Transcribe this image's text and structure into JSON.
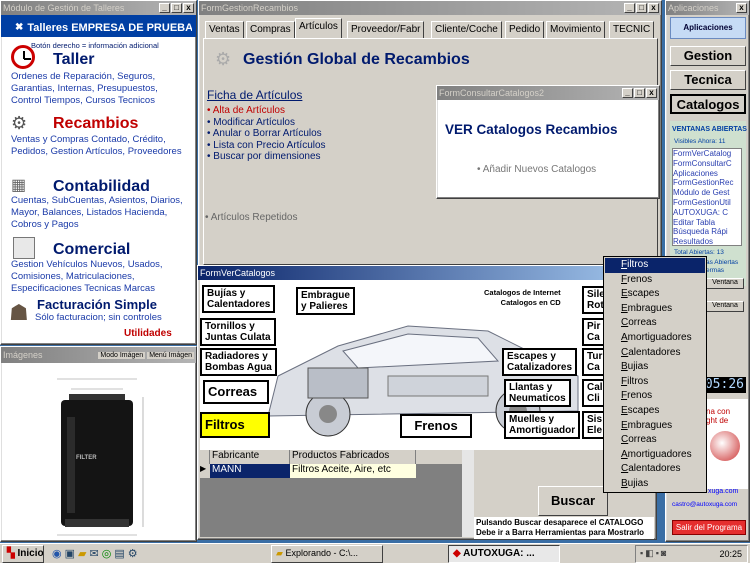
{
  "left_window": {
    "title": "Módulo de Gestión de Talleres",
    "header": "Talleres EMPRESA DE PRUEBAS",
    "hint": "Botón derecho = información adicional",
    "sections": [
      {
        "name": "Taller",
        "desc": "Ordenes de Reparación, Seguros, Garantias, Internas, Presupuestos, Control Tiempos, Cursos Tecnicos"
      },
      {
        "name": "Recambios",
        "desc": "Ventas y Compras Contado, Crédito, Pedidos, Gestion Artículos, Proveedores"
      },
      {
        "name": "Contabilidad",
        "desc": "Cuentas, SubCuentas, Asientos, Diarios, Mayor, Balances, Listados Hacienda, Cobros y Pagos"
      },
      {
        "name": "Comercial",
        "desc": "Gestion Vehículos Nuevos, Usados, Comisiones, Matriculaciones, Especificaciones Tecnicas Marcas"
      }
    ],
    "fact_title": "Facturación Simple",
    "fact_desc": "Sólo facturacion; sin controles",
    "utilidades": "Utilidades"
  },
  "images_window": {
    "title": "Imágenes",
    "mode_btn": "Modo Imágen",
    "menu_btn": "Menú Imágen",
    "filter_brand": "FILTER"
  },
  "gestion_window": {
    "title": "FormGestionRecambios",
    "tabs": [
      "Ventas",
      "Compras",
      "Artículos",
      "Proveedor/Fabr",
      "Cliente/Coche",
      "Pedido",
      "Movimiento",
      "TECNIC"
    ],
    "heading": "Gestión Global de Recambios",
    "ficha_title": "Ficha de Artículos",
    "ficha_items": [
      "Alta de Artículos",
      "Modificar Artículos",
      "Anular o Borrar Artículos",
      "Lista con Precio Artículos",
      "Buscar por dimensiones"
    ],
    "repetidos": "Artículos Repetidos"
  },
  "consultar_window": {
    "title": "FormConsultarCatalogos2",
    "heading": "VER Catalogos Recambios",
    "link": "Añadir Nuevos Catalogos"
  },
  "catalogos_window": {
    "title": "FormVerCatalogos",
    "labels": {
      "bujias": [
        "Bujías y",
        "Calentadores"
      ],
      "embrague": [
        "Embrague",
        "y Palieres"
      ],
      "tornillos": [
        "Tornillos y",
        "Juntas Culata"
      ],
      "radiadores": [
        "Radiadores y",
        "Bombas Agua"
      ],
      "correas": "Correas",
      "filtros": "Filtros",
      "frenos": "Frenos",
      "escapes": [
        "Escapes y",
        "Catalizadores"
      ],
      "llantas": [
        "Llantas y",
        "Neumaticos"
      ],
      "muelles": [
        "Muelles y",
        "Amortiguador"
      ],
      "sil": [
        "Sile",
        "Rot"
      ],
      "pir": [
        "Pir",
        "Ca"
      ],
      "tur": [
        "Tur",
        "Ca"
      ],
      "cal": [
        "Cal",
        "Cli"
      ],
      "sis": [
        "Sis",
        "Ele"
      ]
    },
    "internet_note": [
      "Catalogos de Internet",
      "Catalogos en CD"
    ],
    "grid": {
      "headers": [
        "Fabricante",
        "Productos Fabricados"
      ],
      "rows": [
        [
          "MANN",
          "Filtros Aceite, Aire, etc"
        ]
      ]
    },
    "buscar": "Buscar",
    "note": [
      "Pulsando Buscar desaparece el CATALOGO",
      "Debe ir a Barra Herramientas para Mostrarlo"
    ]
  },
  "dropdown": {
    "items": [
      "Filtros",
      "Frenos",
      "Escapes",
      "Embragues",
      "Correas",
      "Amortiguadores",
      "Calentadores",
      "Bujias",
      "Filtros",
      "Frenos",
      "Escapes",
      "Embragues",
      "Correas",
      "Amortiguadores",
      "Calentadores",
      "Bujias"
    ],
    "selected_index": 0
  },
  "right_window": {
    "title": "Aplicaciones",
    "app_btn": "Aplicaciones",
    "buttons": [
      "Gestion",
      "Tecnica",
      "Catalogos"
    ],
    "ventanas_title": "VENTANAS ABIERTAS",
    "visibles": "Visibles Ahora: 11",
    "list": [
      "FormVerCatalog",
      "FormConsultarC",
      "Aplicaciones",
      "FormGestionRec",
      "Módulo de Gest",
      "FormGestionUtil",
      "AUTOXUGA: C",
      "Editar Tabla",
      "Búsqueda Rápi",
      "Resultados"
    ],
    "total": "Total Abiertas: 13",
    "partial": [
      "as Abiertas",
      "ermas"
    ],
    "btn_small": "Ventana",
    "clock": "05:26",
    "line1": "na con",
    "line2": "ght de",
    "link1": "xuga.com",
    "email": "castro@autoxuga.com",
    "salir": "Salir del Programa"
  },
  "taskbar": {
    "start": "Inicio",
    "tasks": [
      "Explorando - C:\\...",
      "AUTOXUGA: ..."
    ],
    "time": "20:25"
  }
}
